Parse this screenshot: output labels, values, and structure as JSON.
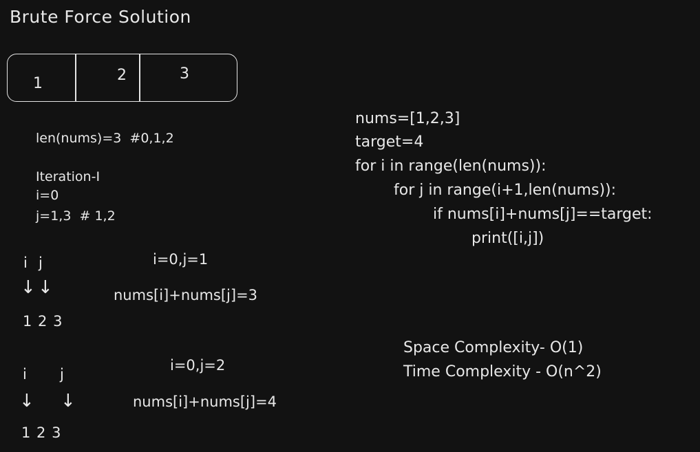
{
  "title": "Brute Force Solution",
  "array_box": {
    "cells": [
      "1",
      "2",
      "3"
    ]
  },
  "notes": {
    "len_line": "len(nums)=3  #0,1,2",
    "iteration": "Iteration-I",
    "i_line": "i=0",
    "j_line": "j=1,3  # 1,2"
  },
  "step1": {
    "i_label": "i",
    "j_label": "j",
    "header": "i=0,j=1",
    "expr": "nums[i]+nums[j]=3",
    "arrow_glyph": "↓",
    "array": "1 2 3"
  },
  "step2": {
    "i_label": "i",
    "j_label": "j",
    "header": "i=0,j=2",
    "expr": "nums[i]+nums[j]=4",
    "arrow_glyph": "↓",
    "array": "1 2 3"
  },
  "code": [
    "nums=[1,2,3]",
    "target=4",
    "for i in range(len(nums)):",
    "for j in range(i+1,len(nums)):",
    "if nums[i]+nums[j]==target:",
    "print([i,j])"
  ],
  "complexity": {
    "space": "Space Complexity- O(1)",
    "time": "Time Complexity - O(n^2)"
  }
}
